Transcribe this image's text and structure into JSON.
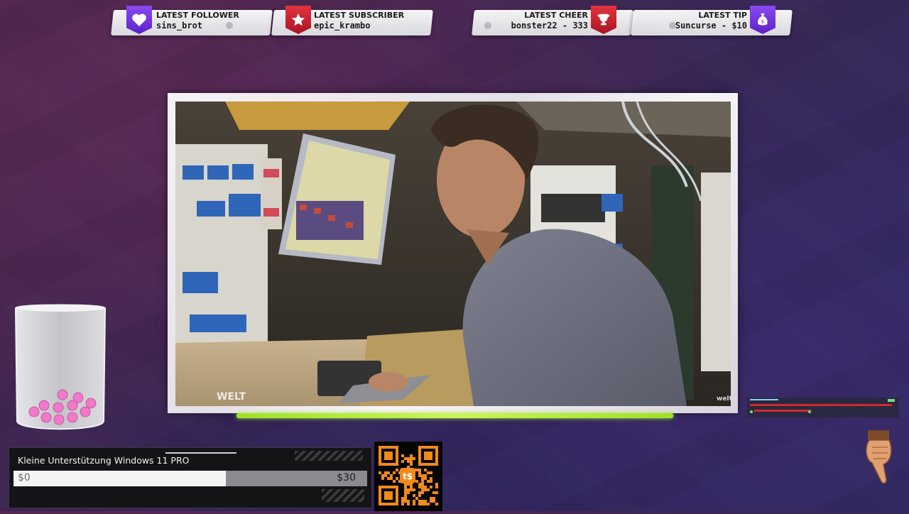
{
  "alerts": {
    "follower": {
      "label": "LATEST FOLLOWER",
      "value": "sins_brot"
    },
    "subscriber": {
      "label": "LATEST SUBSCRIBER",
      "value": "epic_krambo"
    },
    "cheer": {
      "label": "LATEST CHEER",
      "value": "bonster22 - 333"
    },
    "tip": {
      "label": "LATEST TIP",
      "value": "Suncurse - $10"
    }
  },
  "video": {
    "watermark_left": "WELT",
    "watermark_right": "welt"
  },
  "donation_goal": {
    "title": "Kleine Unterstützung Windows 11 PRO",
    "start": "$0",
    "end": "$30",
    "progress_fraction": 0.6
  },
  "qr": {
    "center_label": "t$"
  },
  "colors": {
    "accent_green": "#a6ec3a",
    "badge_purple": "#6a2fd8",
    "badge_red": "#c8202c",
    "qr_orange": "#f08a1c"
  },
  "icons": {
    "follower": "heart-icon",
    "subscriber": "star-icon",
    "cheer": "trophy-icon",
    "tip": "money-bag-icon"
  }
}
